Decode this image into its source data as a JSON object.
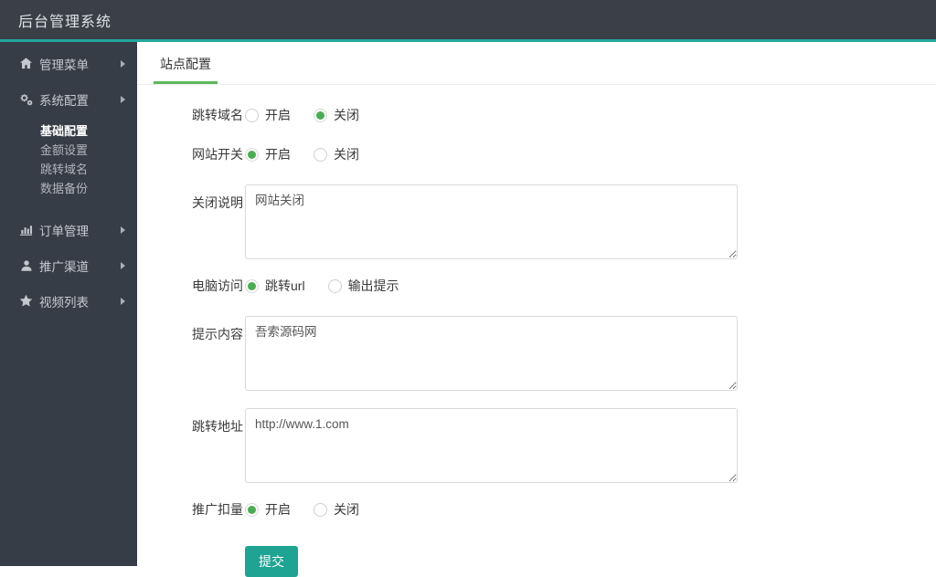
{
  "header": {
    "title": "后台管理系统"
  },
  "sidebar": {
    "items": [
      {
        "label": "管理菜单",
        "icon": "home-icon",
        "expandable": true
      },
      {
        "label": "系统配置",
        "icon": "cogs-icon",
        "expandable": true,
        "expanded": true,
        "children": [
          {
            "label": "基础配置",
            "active": true
          },
          {
            "label": "金额设置",
            "active": false
          },
          {
            "label": "跳转域名",
            "active": false
          },
          {
            "label": "数据备份",
            "active": false
          }
        ]
      },
      {
        "label": "订单管理",
        "icon": "bar-chart-icon",
        "expandable": true
      },
      {
        "label": "推广渠道",
        "icon": "user-icon",
        "expandable": true
      },
      {
        "label": "视频列表",
        "icon": "star-icon",
        "expandable": true
      }
    ]
  },
  "main": {
    "tab": "站点配置",
    "form": {
      "rows": [
        {
          "type": "radio",
          "label": "跳转域名",
          "options": [
            "开启",
            "关闭"
          ],
          "selected": 1
        },
        {
          "type": "radio",
          "label": "网站开关",
          "options": [
            "开启",
            "关闭"
          ],
          "selected": 0
        },
        {
          "type": "textarea",
          "label": "关闭说明",
          "value": "网站关闭"
        },
        {
          "type": "radio",
          "label": "电脑访问",
          "options": [
            "跳转url",
            "输出提示"
          ],
          "selected": 0
        },
        {
          "type": "textarea",
          "label": "提示内容",
          "value": "吾索源码网"
        },
        {
          "type": "textarea",
          "label": "跳转地址",
          "value": "http://www.1.com"
        },
        {
          "type": "radio",
          "label": "推广扣量",
          "options": [
            "开启",
            "关闭"
          ],
          "selected": 0
        }
      ],
      "submit_label": "提交"
    }
  },
  "colors": {
    "accent_teal": "#23a79b",
    "tab_green": "#5cb85c",
    "radio_green": "#4aae51",
    "submit_teal": "#1fa392",
    "header_bg": "#3a3f48",
    "sidebar_bg": "#373d47"
  }
}
